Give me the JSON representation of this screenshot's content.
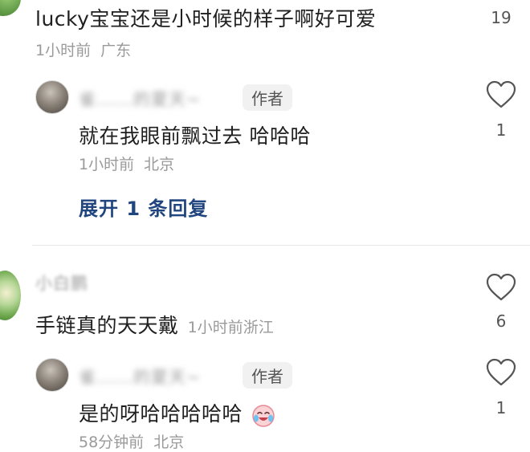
{
  "comments": [
    {
      "text": "lucky宝宝还是小时候的样子啊好可爱",
      "time": "1小时前",
      "location": "广东",
      "likes": "19",
      "icons": {
        "avatar": "avatar-landscape",
        "like": "heart-outline-icon"
      },
      "reply": {
        "username": "雀......的夏天~",
        "badge": "作者",
        "text": "就在我眼前飘过去 哈哈哈",
        "time": "1小时前",
        "location": "北京",
        "likes": "1",
        "icons": {
          "avatar": "avatar-photo",
          "like": "heart-outline-icon"
        }
      },
      "expand_label": "展开 1 条回复"
    },
    {
      "username": "小白鹏",
      "text": "手链真的天天戴",
      "time": "1小时前",
      "location": "浙江",
      "likes": "6",
      "icons": {
        "avatar": "avatar-green",
        "like": "heart-outline-icon"
      },
      "reply": {
        "username": "雀......的夏天~",
        "badge": "作者",
        "text": "是的呀哈哈哈哈哈",
        "time": "58分钟前",
        "location": "北京",
        "likes": "1",
        "icons": {
          "avatar": "avatar-photo",
          "like": "heart-outline-icon",
          "emoji": "crying-laughing-emoji"
        }
      }
    }
  ],
  "colors": {
    "text": "#1f1f1f",
    "meta": "#9a9a9a",
    "expand_link": "#21467f",
    "badge_bg": "#f1f1f1",
    "divider": "#e6e6e6"
  }
}
